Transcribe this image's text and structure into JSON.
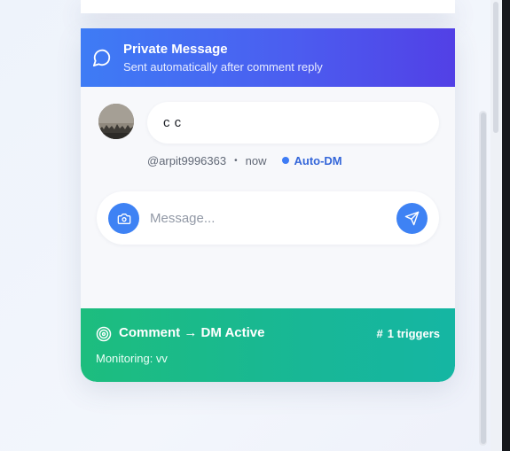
{
  "header": {
    "title": "Private Message",
    "subtitle": "Sent automatically after comment reply",
    "icon": "message-circle-icon"
  },
  "comment": {
    "text": "c c",
    "username": "@arpit9996363",
    "separator": "•",
    "time": "now",
    "badge": "Auto-DM"
  },
  "composer": {
    "placeholder": "Message...",
    "camera_icon": "camera-icon",
    "send_icon": "send-icon"
  },
  "footer": {
    "title": "Comment → DM Active",
    "triggers_icon": "#",
    "triggers": "1 triggers",
    "monitoring": "Monitoring: vv"
  },
  "colors": {
    "header_start": "#3e7cf5",
    "header_end": "#5240e6",
    "accent_blue": "#3e82f4",
    "footer_start": "#1dbd7e",
    "footer_end": "#15b6a3"
  }
}
